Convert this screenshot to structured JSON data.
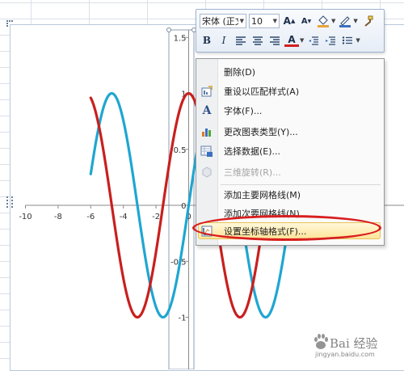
{
  "mini_toolbar": {
    "font_name": "宋体 (正文)",
    "font_size": "10",
    "grow_font_label": "A",
    "shrink_font_label": "A",
    "bold_label": "B",
    "italic_label": "I",
    "font_color_label": "A"
  },
  "context_menu": {
    "items": [
      {
        "label": "删除(D)",
        "icon": "delete-icon",
        "enabled": true
      },
      {
        "label": "重设以匹配样式(A)",
        "icon": "reset-style-icon",
        "enabled": true
      },
      {
        "label": "字体(F)...",
        "icon": "font-icon",
        "enabled": true
      },
      {
        "label": "更改图表类型(Y)...",
        "icon": "chart-type-icon",
        "enabled": true
      },
      {
        "label": "选择数据(E)...",
        "icon": "select-data-icon",
        "enabled": true
      },
      {
        "label": "三维旋转(R)...",
        "icon": "rotation-3d-icon",
        "enabled": false
      },
      {
        "label": "添加主要网格线(M)",
        "icon": "",
        "enabled": true
      },
      {
        "label": "添加次要网格线(N)",
        "icon": "",
        "enabled": true
      },
      {
        "label": "设置坐标轴格式(F)...",
        "icon": "axis-format-icon",
        "enabled": true,
        "highlighted": true
      }
    ]
  },
  "chart_data": {
    "type": "line",
    "title": "",
    "xlabel": "",
    "ylabel": "",
    "xlim": [
      -10,
      10
    ],
    "ylim": [
      -1.5,
      1.5
    ],
    "x_tick_labels": [
      "-10",
      "-8",
      "-6",
      "-4",
      "-2",
      "0"
    ],
    "y_tick_labels": [
      "1.5",
      "1",
      "0.5",
      "0",
      "-0.5",
      "-1"
    ],
    "grid": false,
    "series": [
      {
        "color": "#1fa6d1",
        "function": "sin(x)",
        "x": [
          -6.0,
          -5.0,
          -4.71,
          -4.0,
          -3.0,
          -2.0,
          -1.57,
          -1.0,
          0.0,
          1.0,
          1.57,
          2.0,
          3.0,
          4.0,
          4.71,
          5.0,
          6.0
        ],
        "y": [
          0.28,
          0.96,
          1.0,
          0.76,
          -0.14,
          -0.91,
          -1.0,
          -0.84,
          0.0,
          0.84,
          1.0,
          0.91,
          0.14,
          -0.76,
          -1.0,
          -0.96,
          -0.28
        ]
      },
      {
        "color": "#c8201e",
        "function": "cos(x)",
        "x": [
          -6.0,
          -5.0,
          -4.0,
          -3.14,
          -3.0,
          -2.0,
          -1.0,
          0.0,
          1.0,
          2.0,
          3.0,
          3.14,
          4.0,
          5.0,
          6.0
        ],
        "y": [
          0.96,
          0.28,
          -0.65,
          -1.0,
          -0.99,
          -0.42,
          0.54,
          1.0,
          0.54,
          -0.42,
          -0.99,
          -1.0,
          -0.65,
          0.28,
          0.96
        ]
      }
    ]
  },
  "watermark": {
    "text": "Bai 经验",
    "url": "jingyan.baidu.com"
  }
}
